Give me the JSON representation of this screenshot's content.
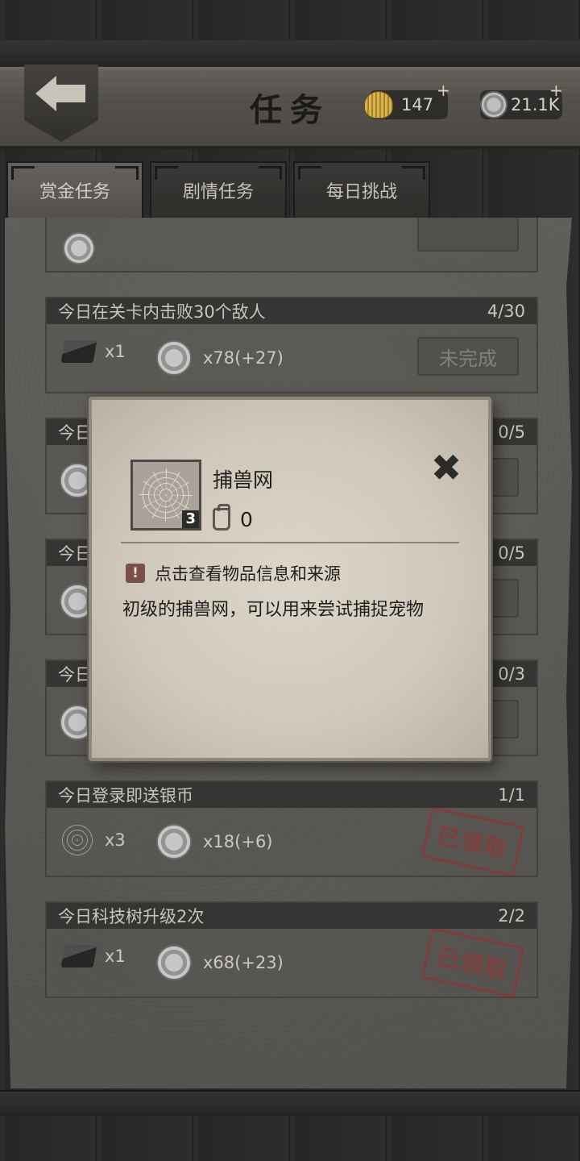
{
  "header": {
    "title": "任务",
    "shells": {
      "icon": "shell-icon",
      "value": "147",
      "plus": "+"
    },
    "coins": {
      "icon": "coin-icon",
      "value": "21.1K",
      "plus": "+"
    }
  },
  "tabs": [
    {
      "label": "赏金任务",
      "active": true
    },
    {
      "label": "剧情任务",
      "active": false
    },
    {
      "label": "每日挑战",
      "active": false
    }
  ],
  "quests": [
    {
      "title": "今日在关卡内击败30个敌人",
      "progress": "4/30",
      "reward1_icon": "ingot-icon",
      "reward1": "x1",
      "reward2": "x78(+27)",
      "status": "未完成",
      "claimed": false
    },
    {
      "title": "今日",
      "progress": "0/5",
      "status": "",
      "claimed": false
    },
    {
      "title": "今日",
      "progress": "0/5",
      "status": "",
      "claimed": false
    },
    {
      "title": "今日",
      "progress": "0/3",
      "status": "",
      "claimed": false
    },
    {
      "title": "今日登录即送银币",
      "progress": "1/1",
      "reward1_icon": "net-icon",
      "reward1": "x3",
      "reward2": "x18(+6)",
      "status": "已领取",
      "claimed": true
    },
    {
      "title": "今日科技树升级2次",
      "progress": "2/2",
      "reward1_icon": "ingot-icon",
      "reward1": "x1",
      "reward2": "x68(+23)",
      "status": "已领取",
      "claimed": true
    }
  ],
  "modal": {
    "item_name": "捕兽网",
    "item_count": "3",
    "owned": "0",
    "info_hint": "点击查看物品信息和来源",
    "info_icon": "!",
    "description": "初级的捕兽网，可以用来尝试捕捉宠物",
    "close_icon": "✖"
  }
}
